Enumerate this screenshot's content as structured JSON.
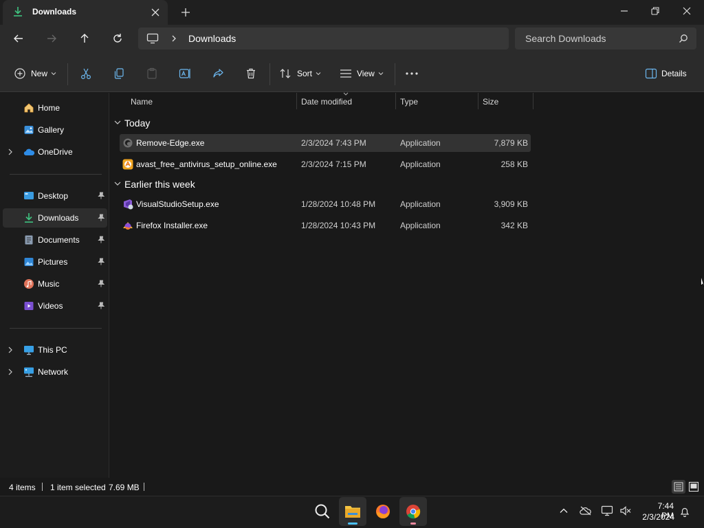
{
  "window": {
    "tab_title": "Downloads"
  },
  "address": {
    "breadcrumb": "Downloads",
    "search_placeholder": "Search Downloads"
  },
  "toolbar": {
    "new_label": "New",
    "sort_label": "Sort",
    "view_label": "View",
    "details_label": "Details"
  },
  "sidebar": {
    "items": [
      {
        "label": "Home",
        "icon": "home-icon"
      },
      {
        "label": "Gallery",
        "icon": "gallery-icon"
      },
      {
        "label": "OneDrive",
        "icon": "onedrive-icon"
      },
      {
        "label": "Desktop",
        "icon": "desktop-icon"
      },
      {
        "label": "Downloads",
        "icon": "downloads-icon"
      },
      {
        "label": "Documents",
        "icon": "documents-icon"
      },
      {
        "label": "Pictures",
        "icon": "pictures-icon"
      },
      {
        "label": "Music",
        "icon": "music-icon"
      },
      {
        "label": "Videos",
        "icon": "videos-icon"
      },
      {
        "label": "This PC",
        "icon": "this-pc-icon"
      },
      {
        "label": "Network",
        "icon": "network-icon"
      }
    ]
  },
  "columns": {
    "name": "Name",
    "date": "Date modified",
    "type": "Type",
    "size": "Size"
  },
  "groups": [
    {
      "label": "Today",
      "files": [
        {
          "name": "Remove-Edge.exe",
          "date": "2/3/2024 7:43 PM",
          "type": "Application",
          "size": "7,879 KB",
          "selected": true
        },
        {
          "name": "avast_free_antivirus_setup_online.exe",
          "date": "2/3/2024 7:15 PM",
          "type": "Application",
          "size": "258 KB",
          "selected": false
        }
      ]
    },
    {
      "label": "Earlier this week",
      "files": [
        {
          "name": "VisualStudioSetup.exe",
          "date": "1/28/2024 10:48 PM",
          "type": "Application",
          "size": "3,909 KB",
          "selected": false
        },
        {
          "name": "Firefox Installer.exe",
          "date": "1/28/2024 10:43 PM",
          "type": "Application",
          "size": "342 KB",
          "selected": false
        }
      ]
    }
  ],
  "status": {
    "item_count": "4 items",
    "selection": "1 item selected",
    "selection_size": "7.69 MB"
  },
  "taskbar": {
    "time": "7:44 PM",
    "date": "2/3/2024"
  },
  "colors": {
    "accent": "#4cc2ff",
    "background": "#191919",
    "chrome": "#2b2b2b"
  }
}
